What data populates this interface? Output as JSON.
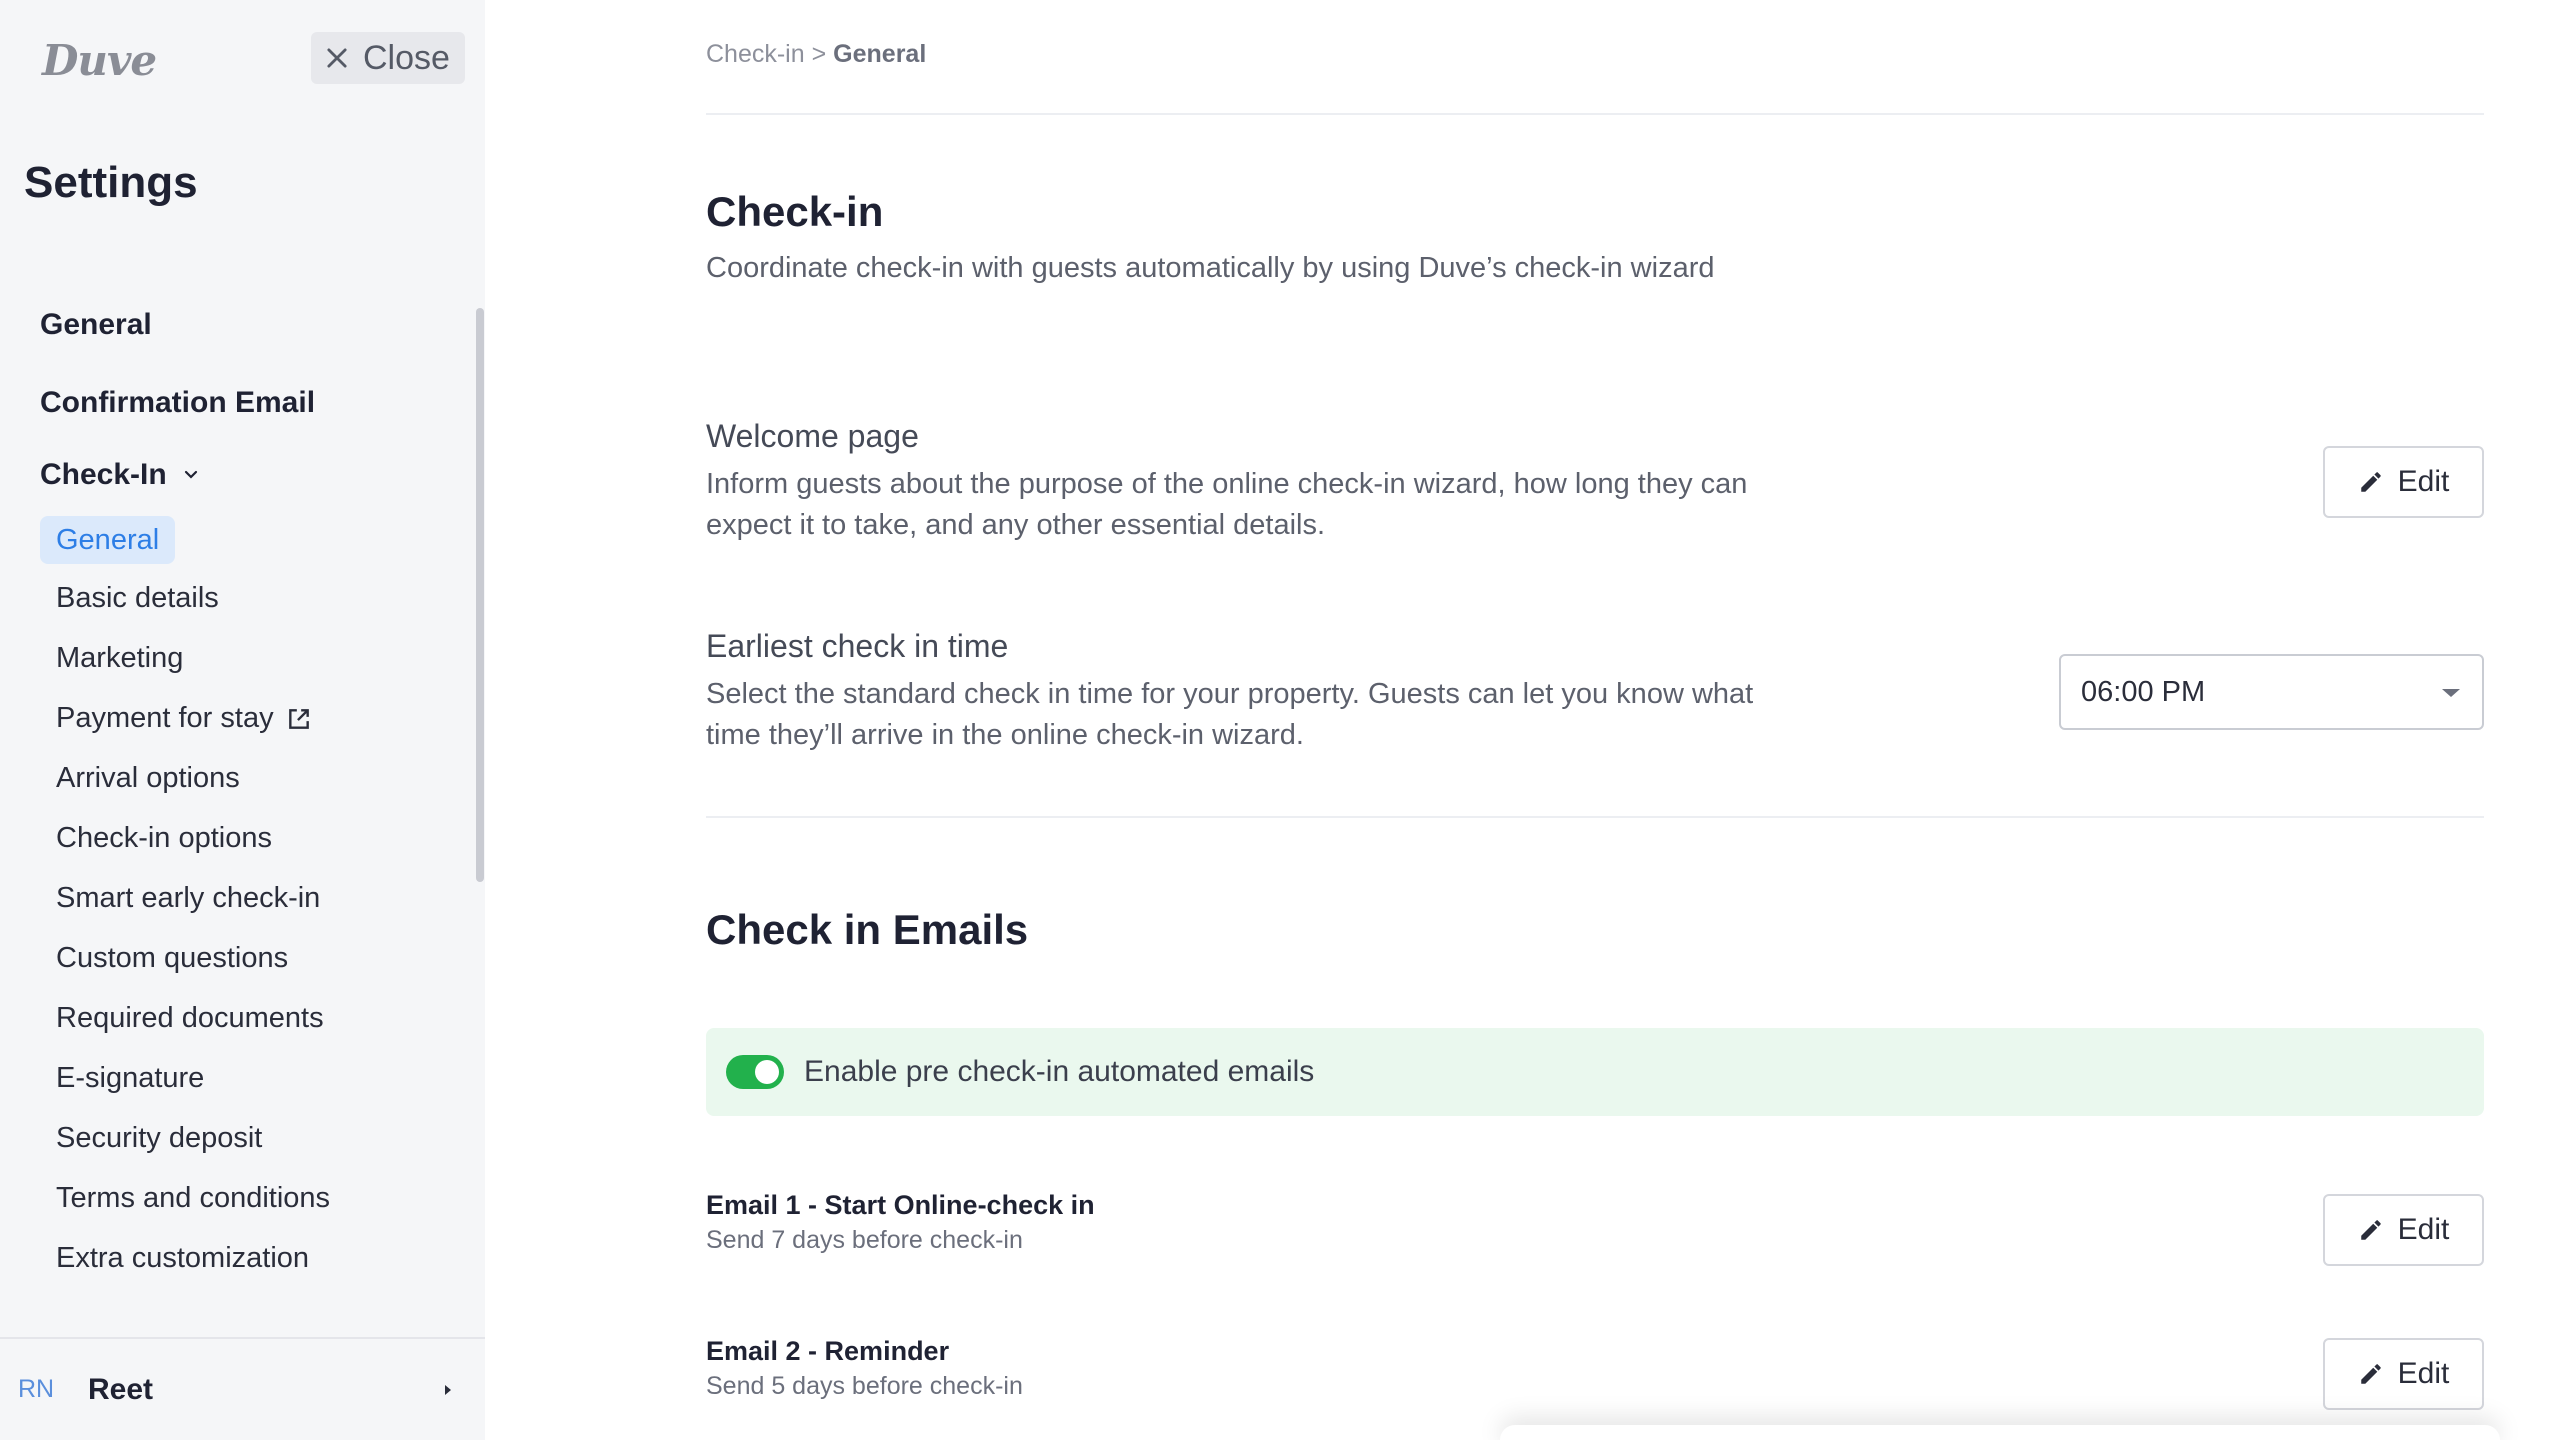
{
  "sidebar": {
    "logo": "Duve",
    "close_label": "Close",
    "settings_title": "Settings",
    "top_items": [
      "General",
      "Confirmation Email"
    ],
    "checkin_group": {
      "label": "Check-In",
      "items": [
        "General",
        "Basic details",
        "Marketing",
        "Payment for stay",
        "Arrival options",
        "Check-in options",
        "Smart early check-in",
        "Custom questions",
        "Required documents",
        "E-signature",
        "Security deposit",
        "Terms and conditions",
        "Extra customization"
      ],
      "active_item": "General"
    },
    "user": {
      "initials": "RN",
      "name": "Reet"
    }
  },
  "main": {
    "breadcrumb": {
      "parent": "Check-in",
      "separator": ">",
      "current": "General"
    },
    "checkin": {
      "title": "Check-in",
      "subtitle": "Coordinate check-in with guests automatically by using Duve’s check-in wizard",
      "welcome": {
        "title": "Welcome page",
        "description": "Inform guests about the purpose of the online check-in wizard, how long they can expect it to take, and any other essential details.",
        "edit_label": "Edit"
      },
      "earliest": {
        "title": "Earliest check in time",
        "description": "Select the standard check in time for your property. Guests can let you know what time they’ll arrive in the online check-in wizard.",
        "selected_time": "06:00 PM"
      }
    },
    "emails": {
      "title": "Check in Emails",
      "toggle_label": "Enable pre check-in automated emails",
      "toggle_on": true,
      "list": [
        {
          "title": "Email 1 - Start Online-check in",
          "subtitle": "Send 7 days before check-in",
          "edit_label": "Edit"
        },
        {
          "title": "Email 2 - Reminder",
          "subtitle": "Send 5 days before check-in",
          "edit_label": "Edit"
        }
      ]
    }
  },
  "colors": {
    "accent_blue": "#2d7ee6",
    "active_bg": "#dbe9fb",
    "toggle_green": "#22b14c",
    "toggle_bar_bg": "#eaf8ee",
    "sidebar_bg": "#f5f6f8"
  },
  "icons": [
    "close-icon",
    "chevron-down-icon",
    "external-link-icon",
    "caret-right-icon",
    "pencil-icon",
    "dropdown-caret-icon"
  ]
}
